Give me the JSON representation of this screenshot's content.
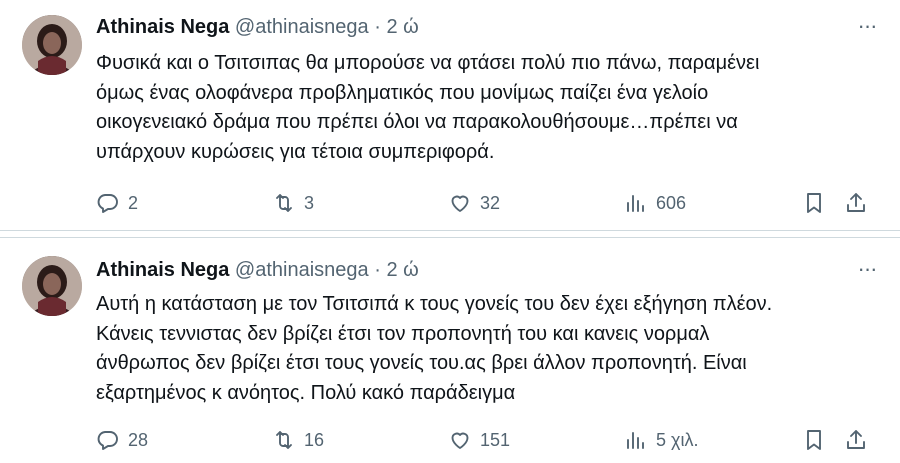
{
  "tweets": [
    {
      "author_name": "Athinais Nega",
      "handle": "@athinaisnega",
      "separator": "·",
      "time": "2 ώ",
      "more_label": "···",
      "text": "Φυσικά και ο Τσιτσιπας θα μπορούσε να φτάσει πολύ πιο πάνω, παραμένει\nόμως ένας ολοφάνερα προβληματικός που μονίμως παίζει ένα γελοίο\nοικογενειακό δράμα που πρέπει όλοι να παρακολουθήσουμε…πρέπει να\nυπάρχουν κυρώσεις για τέτοια συμπεριφορά.",
      "replies": "2",
      "retweets": "3",
      "likes": "32",
      "views": "606"
    },
    {
      "author_name": "Athinais Nega",
      "handle": "@athinaisnega",
      "separator": "·",
      "time": "2 ώ",
      "more_label": "···",
      "text": "Αυτή η κατάσταση με τον Τσιτσιπά κ τους γονείς του δεν έχει εξήγηση πλέον.\nΚάνεις τεννιστας δεν βρίζει έτσι τον προπονητή του και κανεις νορμαλ\nάνθρωπος δεν βρίζει έτσι τους γονείς του.ας βρει άλλον προπονητή. Είναι\nεξαρτημένος κ ανόητος. Πολύ κακό παράδειγμα",
      "replies": "28",
      "retweets": "16",
      "likes": "151",
      "views": "5 χιλ."
    }
  ],
  "icons": {
    "reply": "reply-icon",
    "retweet": "retweet-icon",
    "like": "heart-icon",
    "views": "views-icon",
    "bookmark": "bookmark-icon",
    "share": "share-icon",
    "more": "more-icon"
  },
  "colors": {
    "text": "#0f1419",
    "secondary": "#536471",
    "divider": "#cfd9de"
  }
}
